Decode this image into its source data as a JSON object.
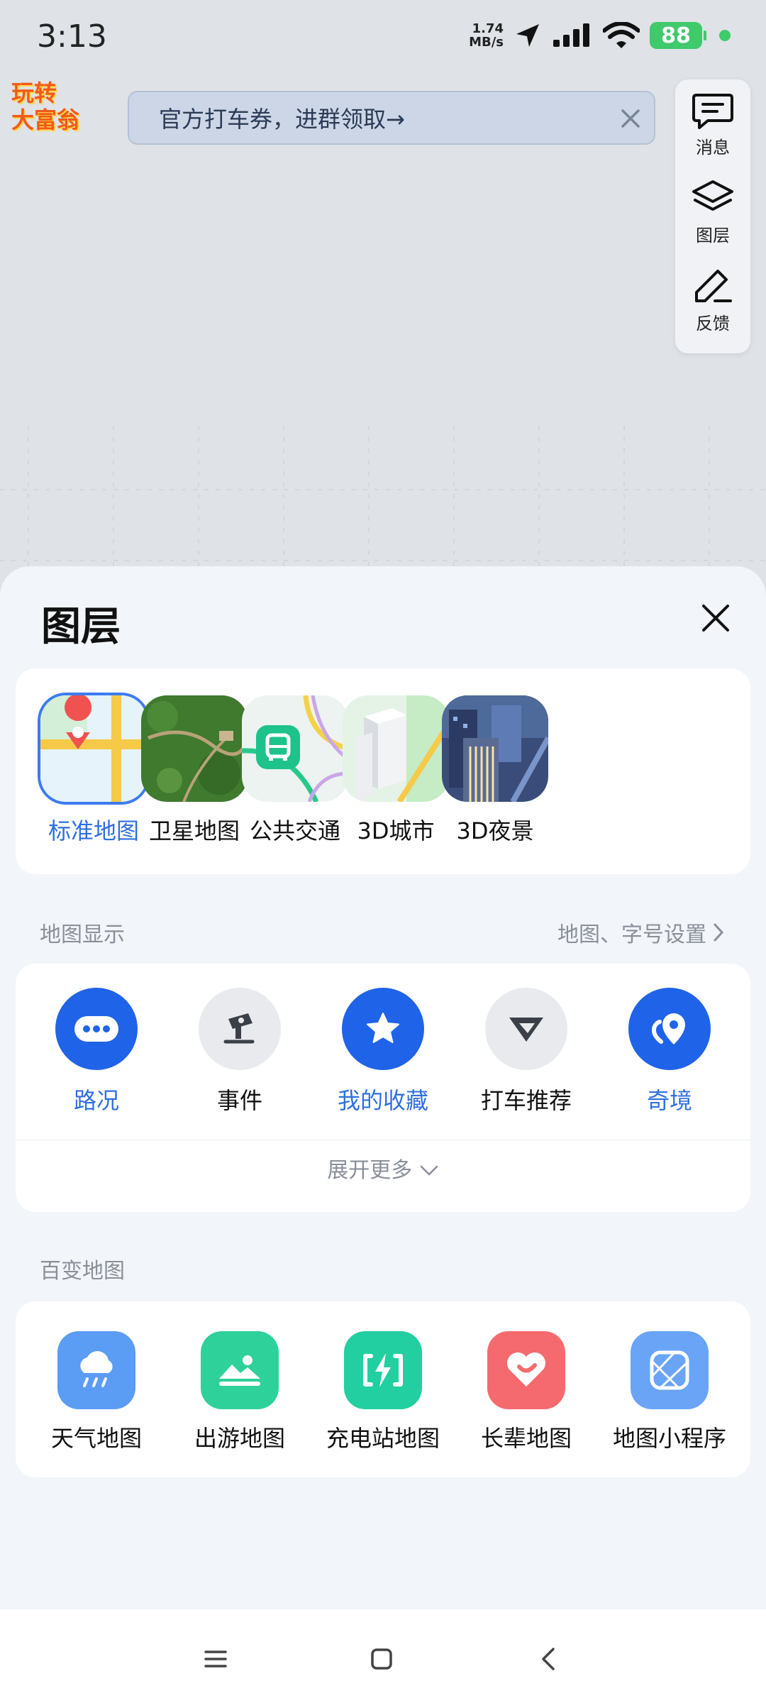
{
  "status_bar": {
    "time": "3:13",
    "net_speed_value": "1.74",
    "net_speed_unit": "MB/s",
    "battery": "88"
  },
  "promo": {
    "logo_line1": "玩转",
    "logo_line2": "大富翁",
    "banner_text": "官方打车券，进群领取→"
  },
  "side_panel": {
    "items": [
      {
        "label": "消息",
        "icon": "message-icon"
      },
      {
        "label": "图层",
        "icon": "layers-icon"
      },
      {
        "label": "反馈",
        "icon": "edit-feedback-icon"
      }
    ]
  },
  "sheet": {
    "title": "图层",
    "map_types": [
      {
        "label": "标准地图",
        "selected": true
      },
      {
        "label": "卫星地图",
        "selected": false
      },
      {
        "label": "公共交通",
        "selected": false
      },
      {
        "label": "3D城市",
        "selected": false
      },
      {
        "label": "3D夜景",
        "selected": false
      }
    ],
    "display_section": {
      "title": "地图显示",
      "settings_link": "地图、字号设置",
      "items": [
        {
          "label": "路况",
          "active": true,
          "icon": "traffic-icon"
        },
        {
          "label": "事件",
          "active": false,
          "icon": "event-icon"
        },
        {
          "label": "我的收藏",
          "active": true,
          "icon": "star-icon"
        },
        {
          "label": "打车推荐",
          "active": false,
          "icon": "taxi-recommend-icon"
        },
        {
          "label": "奇境",
          "active": true,
          "icon": "wonderland-icon"
        }
      ],
      "expand_more": "展开更多"
    },
    "tools_section": {
      "title": "百变地图",
      "items": [
        {
          "label": "天气地图",
          "icon": "weather-icon",
          "color": "#5b9cf5"
        },
        {
          "label": "出游地图",
          "icon": "travel-icon",
          "color": "#2ed19a"
        },
        {
          "label": "充电站地图",
          "icon": "charging-icon",
          "color": "#22cfa0"
        },
        {
          "label": "长辈地图",
          "icon": "heart-icon",
          "color": "#f56a6e"
        },
        {
          "label": "地图小程序",
          "icon": "mini-program-icon",
          "color": "#6aa4f7"
        }
      ]
    }
  },
  "colors": {
    "accent": "#2f6fe0",
    "active_circle": "#1f63e8",
    "battery": "#3fca6b"
  }
}
